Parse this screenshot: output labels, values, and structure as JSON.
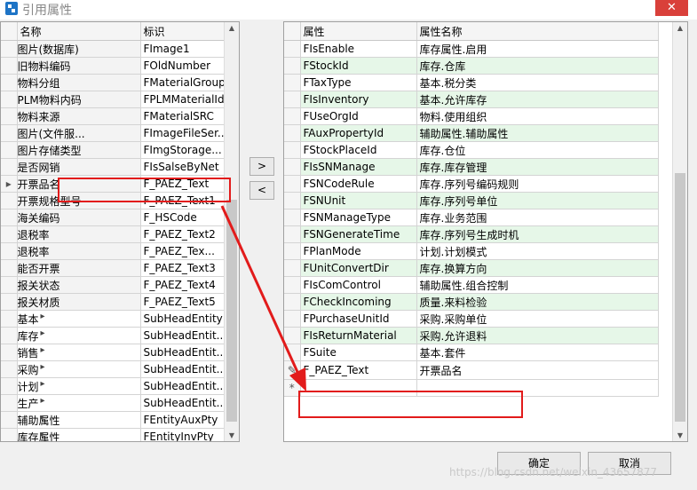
{
  "window": {
    "title": "引用属性",
    "close": "✕"
  },
  "left_grid": {
    "col_name": "名称",
    "col_id": "标识",
    "rows": [
      {
        "name": "图片(数据库)",
        "id": "FImage1",
        "indent": 2,
        "expand": ""
      },
      {
        "name": "旧物料编码",
        "id": "FOldNumber",
        "indent": 2,
        "expand": ""
      },
      {
        "name": "物料分组",
        "id": "FMaterialGroup",
        "indent": 2,
        "expand": ""
      },
      {
        "name": "PLM物料内码",
        "id": "FPLMMaterialId",
        "indent": 2,
        "expand": ""
      },
      {
        "name": "物料来源",
        "id": "FMaterialSRC",
        "indent": 2,
        "expand": ""
      },
      {
        "name": "图片(文件服...",
        "id": "FImageFileSer...",
        "indent": 2,
        "expand": ""
      },
      {
        "name": "图片存储类型",
        "id": "FImgStorage...",
        "indent": 2,
        "expand": ""
      },
      {
        "name": "是否网销",
        "id": "FIsSalseByNet",
        "indent": 2,
        "expand": ""
      },
      {
        "name": "开票品名",
        "id": "F_PAEZ_Text",
        "indent": 2,
        "expand": ""
      },
      {
        "name": "开票规格型号",
        "id": "F_PAEZ_Text1",
        "indent": 2,
        "expand": ""
      },
      {
        "name": "海关编码",
        "id": "F_HSCode",
        "indent": 2,
        "expand": ""
      },
      {
        "name": "退税率",
        "id": "F_PAEZ_Text2",
        "indent": 2,
        "expand": ""
      },
      {
        "name": "退税率",
        "id": "F_PAEZ_Tex...",
        "indent": 2,
        "expand": ""
      },
      {
        "name": "能否开票",
        "id": "F_PAEZ_Text3",
        "indent": 2,
        "expand": ""
      },
      {
        "name": "报关状态",
        "id": "F_PAEZ_Text4",
        "indent": 2,
        "expand": ""
      },
      {
        "name": "报关材质",
        "id": "F_PAEZ_Text5",
        "indent": 2,
        "expand": ""
      },
      {
        "name": "基本",
        "id": "SubHeadEntity",
        "indent": 1,
        "expand": "▸"
      },
      {
        "name": "库存",
        "id": "SubHeadEntit...",
        "indent": 1,
        "expand": "▸"
      },
      {
        "name": "销售",
        "id": "SubHeadEntit...",
        "indent": 1,
        "expand": "▸"
      },
      {
        "name": "采购",
        "id": "SubHeadEntit...",
        "indent": 1,
        "expand": "▸"
      },
      {
        "name": "计划",
        "id": "SubHeadEntit...",
        "indent": 1,
        "expand": "▸"
      },
      {
        "name": "生产",
        "id": "SubHeadEntit...",
        "indent": 1,
        "expand": "▸"
      },
      {
        "name": "辅助属性",
        "id": "FEntityAuxPty",
        "indent": 1,
        "expand": "▸"
      },
      {
        "name": "库存属性",
        "id": "FEntityInvPty",
        "indent": 1,
        "expand": "▸"
      }
    ],
    "current_row_marker": "▸"
  },
  "move_right_label": ">",
  "move_left_label": "<",
  "right_grid": {
    "col_attr": "属性",
    "col_attr_name": "属性名称",
    "rows": [
      {
        "attr": "FIsEnable",
        "name": "库存属性.启用",
        "green": false
      },
      {
        "attr": "FStockId",
        "name": "库存.仓库",
        "green": true
      },
      {
        "attr": "FTaxType",
        "name": "基本.税分类",
        "green": false
      },
      {
        "attr": "FIsInventory",
        "name": "基本.允许库存",
        "green": true
      },
      {
        "attr": "FUseOrgId",
        "name": "物料.使用组织",
        "green": false
      },
      {
        "attr": "FAuxPropertyId",
        "name": "辅助属性.辅助属性",
        "green": true
      },
      {
        "attr": "FStockPlaceId",
        "name": "库存.仓位",
        "green": false
      },
      {
        "attr": "FIsSNManage",
        "name": "库存.库存管理",
        "green": true
      },
      {
        "attr": "FSNCodeRule",
        "name": "库存.序列号编码规则",
        "green": false
      },
      {
        "attr": "FSNUnit",
        "name": "库存.序列号单位",
        "green": true
      },
      {
        "attr": "FSNManageType",
        "name": "库存.业务范围",
        "green": false
      },
      {
        "attr": "FSNGenerateTime",
        "name": "库存.序列号生成时机",
        "green": true
      },
      {
        "attr": "FPlanMode",
        "name": "计划.计划模式",
        "green": false
      },
      {
        "attr": "FUnitConvertDir",
        "name": "库存.换算方向",
        "green": true
      },
      {
        "attr": "FIsComControl",
        "name": "辅助属性.组合控制",
        "green": false
      },
      {
        "attr": "FCheckIncoming",
        "name": "质量.来料检验",
        "green": true
      },
      {
        "attr": "FPurchaseUnitId",
        "name": "采购.采购单位",
        "green": false
      },
      {
        "attr": "FIsReturnMaterial",
        "name": "采购.允许退料",
        "green": true
      },
      {
        "attr": "FSuite",
        "name": "基本.套件",
        "green": false
      },
      {
        "attr": "F_PAEZ_Text",
        "name": "开票品名",
        "green": false
      }
    ],
    "edit_marker": "✎",
    "new_marker": "*"
  },
  "ok_label": "确定",
  "cancel_label": "取消",
  "watermark": "https://blog.csdn.net/weixin_43657877"
}
